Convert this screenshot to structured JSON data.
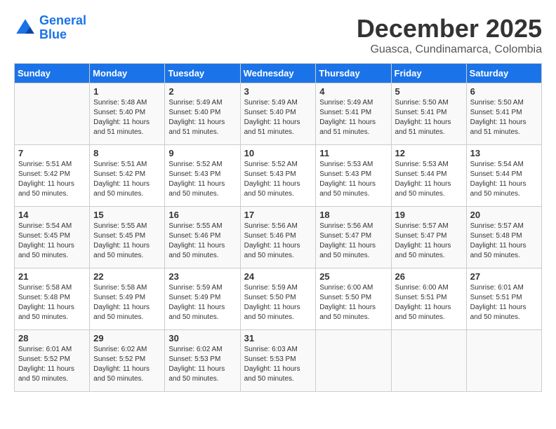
{
  "header": {
    "logo_line1": "General",
    "logo_line2": "Blue",
    "title": "December 2025",
    "subtitle": "Guasca, Cundinamarca, Colombia"
  },
  "days_of_week": [
    "Sunday",
    "Monday",
    "Tuesday",
    "Wednesday",
    "Thursday",
    "Friday",
    "Saturday"
  ],
  "weeks": [
    [
      {
        "day": "",
        "info": ""
      },
      {
        "day": "1",
        "info": "Sunrise: 5:48 AM\nSunset: 5:40 PM\nDaylight: 11 hours\nand 51 minutes."
      },
      {
        "day": "2",
        "info": "Sunrise: 5:49 AM\nSunset: 5:40 PM\nDaylight: 11 hours\nand 51 minutes."
      },
      {
        "day": "3",
        "info": "Sunrise: 5:49 AM\nSunset: 5:40 PM\nDaylight: 11 hours\nand 51 minutes."
      },
      {
        "day": "4",
        "info": "Sunrise: 5:49 AM\nSunset: 5:41 PM\nDaylight: 11 hours\nand 51 minutes."
      },
      {
        "day": "5",
        "info": "Sunrise: 5:50 AM\nSunset: 5:41 PM\nDaylight: 11 hours\nand 51 minutes."
      },
      {
        "day": "6",
        "info": "Sunrise: 5:50 AM\nSunset: 5:41 PM\nDaylight: 11 hours\nand 51 minutes."
      }
    ],
    [
      {
        "day": "7",
        "info": "Sunrise: 5:51 AM\nSunset: 5:42 PM\nDaylight: 11 hours\nand 50 minutes."
      },
      {
        "day": "8",
        "info": "Sunrise: 5:51 AM\nSunset: 5:42 PM\nDaylight: 11 hours\nand 50 minutes."
      },
      {
        "day": "9",
        "info": "Sunrise: 5:52 AM\nSunset: 5:43 PM\nDaylight: 11 hours\nand 50 minutes."
      },
      {
        "day": "10",
        "info": "Sunrise: 5:52 AM\nSunset: 5:43 PM\nDaylight: 11 hours\nand 50 minutes."
      },
      {
        "day": "11",
        "info": "Sunrise: 5:53 AM\nSunset: 5:43 PM\nDaylight: 11 hours\nand 50 minutes."
      },
      {
        "day": "12",
        "info": "Sunrise: 5:53 AM\nSunset: 5:44 PM\nDaylight: 11 hours\nand 50 minutes."
      },
      {
        "day": "13",
        "info": "Sunrise: 5:54 AM\nSunset: 5:44 PM\nDaylight: 11 hours\nand 50 minutes."
      }
    ],
    [
      {
        "day": "14",
        "info": "Sunrise: 5:54 AM\nSunset: 5:45 PM\nDaylight: 11 hours\nand 50 minutes."
      },
      {
        "day": "15",
        "info": "Sunrise: 5:55 AM\nSunset: 5:45 PM\nDaylight: 11 hours\nand 50 minutes."
      },
      {
        "day": "16",
        "info": "Sunrise: 5:55 AM\nSunset: 5:46 PM\nDaylight: 11 hours\nand 50 minutes."
      },
      {
        "day": "17",
        "info": "Sunrise: 5:56 AM\nSunset: 5:46 PM\nDaylight: 11 hours\nand 50 minutes."
      },
      {
        "day": "18",
        "info": "Sunrise: 5:56 AM\nSunset: 5:47 PM\nDaylight: 11 hours\nand 50 minutes."
      },
      {
        "day": "19",
        "info": "Sunrise: 5:57 AM\nSunset: 5:47 PM\nDaylight: 11 hours\nand 50 minutes."
      },
      {
        "day": "20",
        "info": "Sunrise: 5:57 AM\nSunset: 5:48 PM\nDaylight: 11 hours\nand 50 minutes."
      }
    ],
    [
      {
        "day": "21",
        "info": "Sunrise: 5:58 AM\nSunset: 5:48 PM\nDaylight: 11 hours\nand 50 minutes."
      },
      {
        "day": "22",
        "info": "Sunrise: 5:58 AM\nSunset: 5:49 PM\nDaylight: 11 hours\nand 50 minutes."
      },
      {
        "day": "23",
        "info": "Sunrise: 5:59 AM\nSunset: 5:49 PM\nDaylight: 11 hours\nand 50 minutes."
      },
      {
        "day": "24",
        "info": "Sunrise: 5:59 AM\nSunset: 5:50 PM\nDaylight: 11 hours\nand 50 minutes."
      },
      {
        "day": "25",
        "info": "Sunrise: 6:00 AM\nSunset: 5:50 PM\nDaylight: 11 hours\nand 50 minutes."
      },
      {
        "day": "26",
        "info": "Sunrise: 6:00 AM\nSunset: 5:51 PM\nDaylight: 11 hours\nand 50 minutes."
      },
      {
        "day": "27",
        "info": "Sunrise: 6:01 AM\nSunset: 5:51 PM\nDaylight: 11 hours\nand 50 minutes."
      }
    ],
    [
      {
        "day": "28",
        "info": "Sunrise: 6:01 AM\nSunset: 5:52 PM\nDaylight: 11 hours\nand 50 minutes."
      },
      {
        "day": "29",
        "info": "Sunrise: 6:02 AM\nSunset: 5:52 PM\nDaylight: 11 hours\nand 50 minutes."
      },
      {
        "day": "30",
        "info": "Sunrise: 6:02 AM\nSunset: 5:53 PM\nDaylight: 11 hours\nand 50 minutes."
      },
      {
        "day": "31",
        "info": "Sunrise: 6:03 AM\nSunset: 5:53 PM\nDaylight: 11 hours\nand 50 minutes."
      },
      {
        "day": "",
        "info": ""
      },
      {
        "day": "",
        "info": ""
      },
      {
        "day": "",
        "info": ""
      }
    ]
  ]
}
